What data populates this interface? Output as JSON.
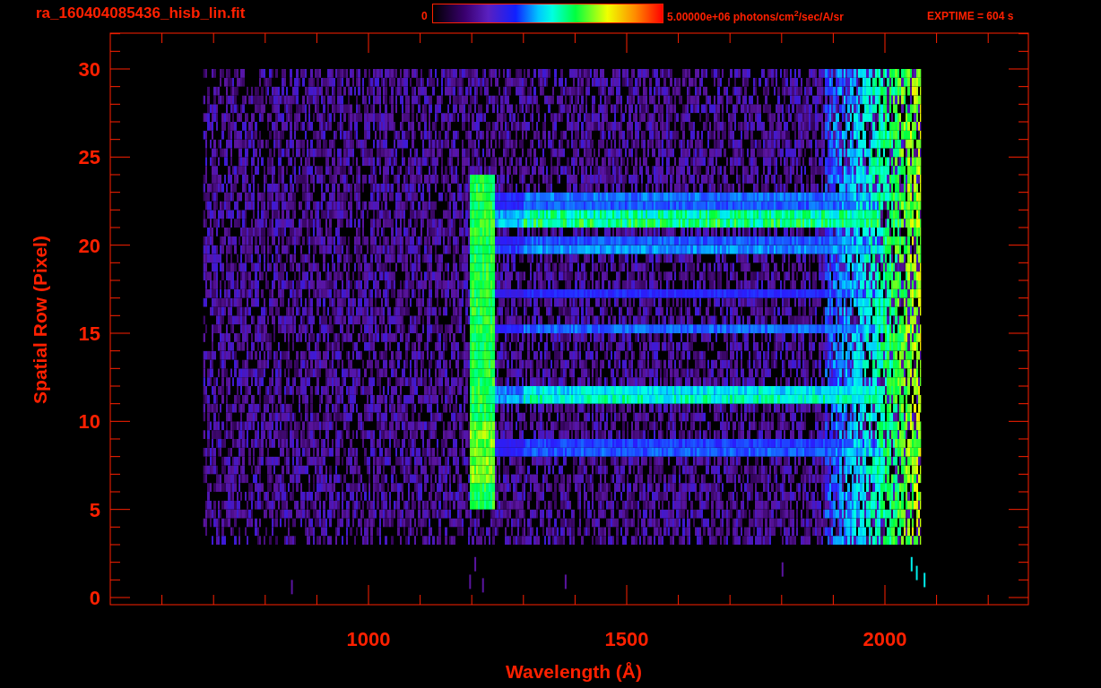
{
  "header": {
    "title": "ra_160404085436_hisb_lin.fit",
    "colorbar_min": "0",
    "colorbar_max": "5.00000e+06 photons/cm$^{2}$/sec/A/sr",
    "exptime": "EXPTIME = 604 s"
  },
  "plot": {
    "y_title": "Spatial Row (Pixel)",
    "x_title": "Wavelength (Å)",
    "y_tick_labels": [
      "30",
      "25",
      "20",
      "15",
      "10",
      "5",
      "0"
    ],
    "x_tick_labels": [
      "1000",
      "1500",
      "2000"
    ]
  }
}
